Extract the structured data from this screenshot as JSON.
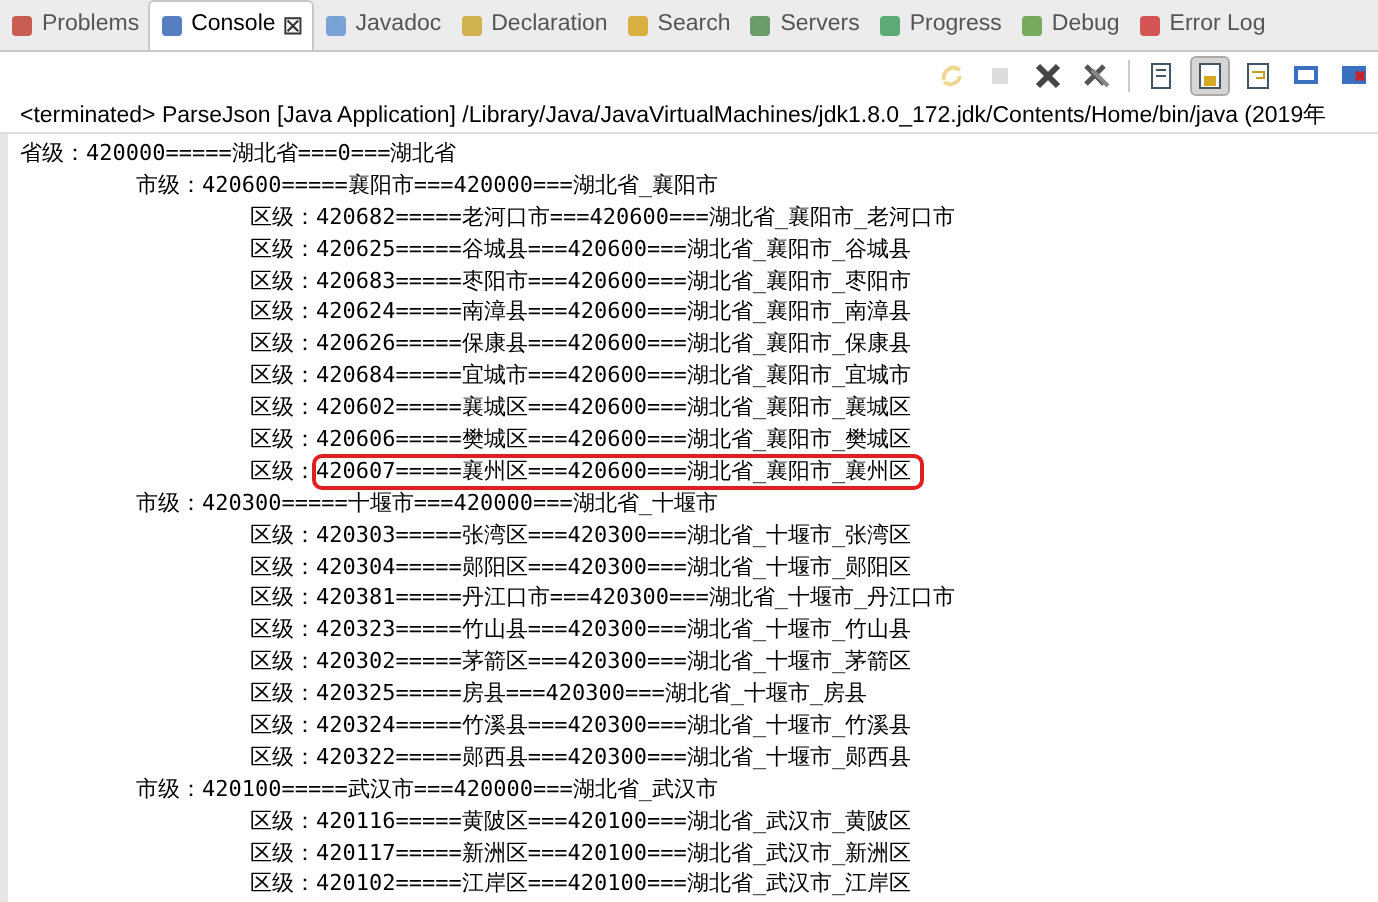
{
  "tabs": [
    {
      "label": "Problems",
      "selected": false
    },
    {
      "label": "Console",
      "selected": true,
      "close_glyph": "⊠"
    },
    {
      "label": "Javadoc",
      "selected": false
    },
    {
      "label": "Declaration",
      "selected": false
    },
    {
      "label": "Search",
      "selected": false
    },
    {
      "label": "Servers",
      "selected": false
    },
    {
      "label": "Progress",
      "selected": false
    },
    {
      "label": "Debug",
      "selected": false
    },
    {
      "label": "Error Log",
      "selected": false
    }
  ],
  "toolbar": [
    {
      "kind": "relaunch",
      "disabled": true
    },
    {
      "kind": "stop",
      "disabled": true
    },
    {
      "kind": "remove",
      "disabled": false
    },
    {
      "kind": "remove-all",
      "disabled": false
    },
    {
      "kind": "clear",
      "disabled": false
    },
    {
      "kind": "scroll-lock",
      "disabled": false,
      "on": true
    },
    {
      "kind": "word-wrap",
      "disabled": false,
      "on": false
    },
    {
      "kind": "pin",
      "disabled": false,
      "on": false
    },
    {
      "kind": "display",
      "disabled": false
    }
  ],
  "process_line": "<terminated> ParseJson [Java Application] /Library/Java/JavaVirtualMachines/jdk1.8.0_172.jdk/Contents/Home/bin/java (2019年",
  "output": [
    {
      "label": "省级：",
      "value": "420000=====湖北省===0===湖北省",
      "highlighted": false,
      "children": [
        {
          "label": "市级：",
          "value": "420600=====襄阳市===420000===湖北省_襄阳市",
          "highlighted": false,
          "children": [
            {
              "label": "区级：",
              "value": "420682=====老河口市===420600===湖北省_襄阳市_老河口市",
              "highlighted": false
            },
            {
              "label": "区级：",
              "value": "420625=====谷城县===420600===湖北省_襄阳市_谷城县",
              "highlighted": false
            },
            {
              "label": "区级：",
              "value": "420683=====枣阳市===420600===湖北省_襄阳市_枣阳市",
              "highlighted": false
            },
            {
              "label": "区级：",
              "value": "420624=====南漳县===420600===湖北省_襄阳市_南漳县",
              "highlighted": false
            },
            {
              "label": "区级：",
              "value": "420626=====保康县===420600===湖北省_襄阳市_保康县",
              "highlighted": false
            },
            {
              "label": "区级：",
              "value": "420684=====宜城市===420600===湖北省_襄阳市_宜城市",
              "highlighted": false
            },
            {
              "label": "区级：",
              "value": "420602=====襄城区===420600===湖北省_襄阳市_襄城区",
              "highlighted": false
            },
            {
              "label": "区级：",
              "value": "420606=====樊城区===420600===湖北省_襄阳市_樊城区",
              "highlighted": false
            },
            {
              "label": "区级：",
              "value": "420607=====襄州区===420600===湖北省_襄阳市_襄州区",
              "highlighted": true
            }
          ]
        },
        {
          "label": "市级：",
          "value": "420300=====十堰市===420000===湖北省_十堰市",
          "highlighted": false,
          "children": [
            {
              "label": "区级：",
              "value": "420303=====张湾区===420300===湖北省_十堰市_张湾区",
              "highlighted": false
            },
            {
              "label": "区级：",
              "value": "420304=====郧阳区===420300===湖北省_十堰市_郧阳区",
              "highlighted": false
            },
            {
              "label": "区级：",
              "value": "420381=====丹江口市===420300===湖北省_十堰市_丹江口市",
              "highlighted": false
            },
            {
              "label": "区级：",
              "value": "420323=====竹山县===420300===湖北省_十堰市_竹山县",
              "highlighted": false
            },
            {
              "label": "区级：",
              "value": "420302=====茅箭区===420300===湖北省_十堰市_茅箭区",
              "highlighted": false
            },
            {
              "label": "区级：",
              "value": "420325=====房县===420300===湖北省_十堰市_房县",
              "highlighted": false
            },
            {
              "label": "区级：",
              "value": "420324=====竹溪县===420300===湖北省_十堰市_竹溪县",
              "highlighted": false
            },
            {
              "label": "区级：",
              "value": "420322=====郧西县===420300===湖北省_十堰市_郧西县",
              "highlighted": false
            }
          ]
        },
        {
          "label": "市级：",
          "value": "420100=====武汉市===420000===湖北省_武汉市",
          "highlighted": false,
          "children": [
            {
              "label": "区级：",
              "value": "420116=====黄陂区===420100===湖北省_武汉市_黄陂区",
              "highlighted": false
            },
            {
              "label": "区级：",
              "value": "420117=====新洲区===420100===湖北省_武汉市_新洲区",
              "highlighted": false
            },
            {
              "label": "区级：",
              "value": "420102=====江岸区===420100===湖北省_武汉市_江岸区",
              "highlighted": false
            }
          ]
        }
      ]
    }
  ]
}
